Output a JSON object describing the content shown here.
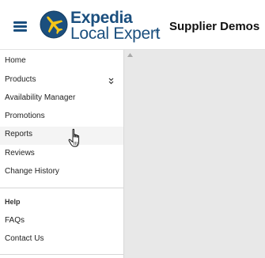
{
  "header": {
    "menu_icon": "hamburger-menu-icon",
    "logo_icon": "expedia-globe-plane-logo",
    "brand_top": "Expedia",
    "brand_bottom": "Local Expert",
    "brand_tm": "®",
    "supplier_name": "Supplier Demos",
    "brand_color": "#1b4f7e",
    "accent_color": "#f5c518"
  },
  "sidebar": {
    "items": [
      {
        "label": "Home"
      },
      {
        "label": "Products",
        "icon": "double-chevron-down-icon"
      },
      {
        "label": "Availability Manager"
      },
      {
        "label": "Promotions"
      },
      {
        "label": "Reports",
        "state": "hovered"
      },
      {
        "label": "Reviews"
      },
      {
        "label": "Change History"
      }
    ],
    "help_heading": "Help",
    "help_items": [
      {
        "label": "FAQs"
      },
      {
        "label": "Contact Us"
      }
    ]
  },
  "content": {
    "background_color": "#e8e8e8",
    "scroll_icon": "scroll-up-arrow-icon"
  },
  "cursor": {
    "icon": "pointing-hand-cursor-icon"
  }
}
